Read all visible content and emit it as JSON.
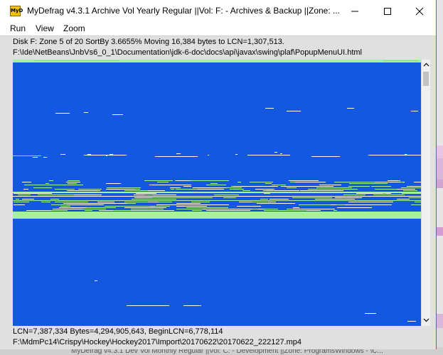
{
  "window": {
    "title": "MyDefrag v4.3.1    Archive Vol Yearly Regular ||Vol: F: - Archives & Backup ||Zone: ...",
    "app_icon_text": "MyD",
    "controls": {
      "minimize": "minimize-icon",
      "maximize": "maximize-icon",
      "close": "close-icon"
    }
  },
  "menu": {
    "items": [
      {
        "label": "Run"
      },
      {
        "label": "View"
      },
      {
        "label": "Zoom"
      }
    ]
  },
  "status": {
    "line1": "Disk F:   Zone 5 of 20   SortBy   3.6655%   Moving 16,384 bytes to LCN=1,307,513.",
    "line2": "F:\\Ide\\NetBeans\\JnbVs6_0_1\\Documentation\\jdk-6-doc\\docs\\api\\javax\\swing\\plaf\\PopupMenuUI.html",
    "line3": "LCN=7,387,334     Bytes=4,294,905,643,  BeginLCN=6,778,114",
    "line4": "F:\\MdmPc14\\Crispy\\Hockey\\Hockey2017\\Import\\20170622\\20170622_222127.mp4"
  },
  "diskmap": {
    "colors": {
      "free": "#1457e0",
      "file": "#ffffff",
      "moved": "#a7f0a0",
      "fragment": "#f2c200"
    }
  },
  "background": {
    "taskbar_text": "MyDefrag v4.3.1   Dev Vol Monthly Regular ||Vol: C: - Development ||Zone: ProgramsWindows - \\C..."
  }
}
